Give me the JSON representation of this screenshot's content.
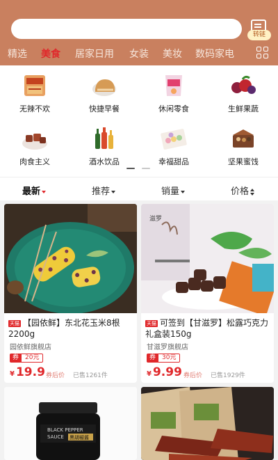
{
  "header": {
    "convert_label": "转链",
    "tabs": [
      "精选",
      "美食",
      "居家日用",
      "女装",
      "美妆",
      "数码家电"
    ],
    "active_tab": "美食"
  },
  "categories": [
    {
      "label": "无辣不欢"
    },
    {
      "label": "快捷早餐"
    },
    {
      "label": "休闲零食"
    },
    {
      "label": "生鲜果蔬"
    },
    {
      "label": "肉食主义"
    },
    {
      "label": "酒水饮品"
    },
    {
      "label": "幸福甜品"
    },
    {
      "label": "坚果蜜饯"
    }
  ],
  "sort": {
    "items": [
      "最新",
      "推荐",
      "销量",
      "价格"
    ],
    "active": "最新"
  },
  "products": [
    {
      "badge": "天猫",
      "title": "【园依鲜】东北花玉米8根2200g",
      "shop": "园依鲜旗舰店",
      "coupon_label": "券",
      "coupon_value": "20元",
      "price_symbol": "¥",
      "price": "19.9",
      "price_note": "券后价",
      "sold": "已售1261件"
    },
    {
      "badge": "天猫",
      "title": "可签到【甘滋罗】松露巧克力礼盒装150g",
      "shop": "甘滋罗旗舰店",
      "coupon_label": "券",
      "coupon_value": "30元",
      "price_symbol": "¥",
      "price": "9.99",
      "price_note": "券后价",
      "sold": "已售1929件"
    },
    {
      "jar_label_1": "BLACK PEPPER",
      "jar_label_2": "SAUCE",
      "jar_label_cn": "黑胡椒酱"
    },
    {}
  ],
  "colors": {
    "header_bg": "#c9805f",
    "accent_red": "#e0282b",
    "page_bg": "#f2f2f2"
  }
}
